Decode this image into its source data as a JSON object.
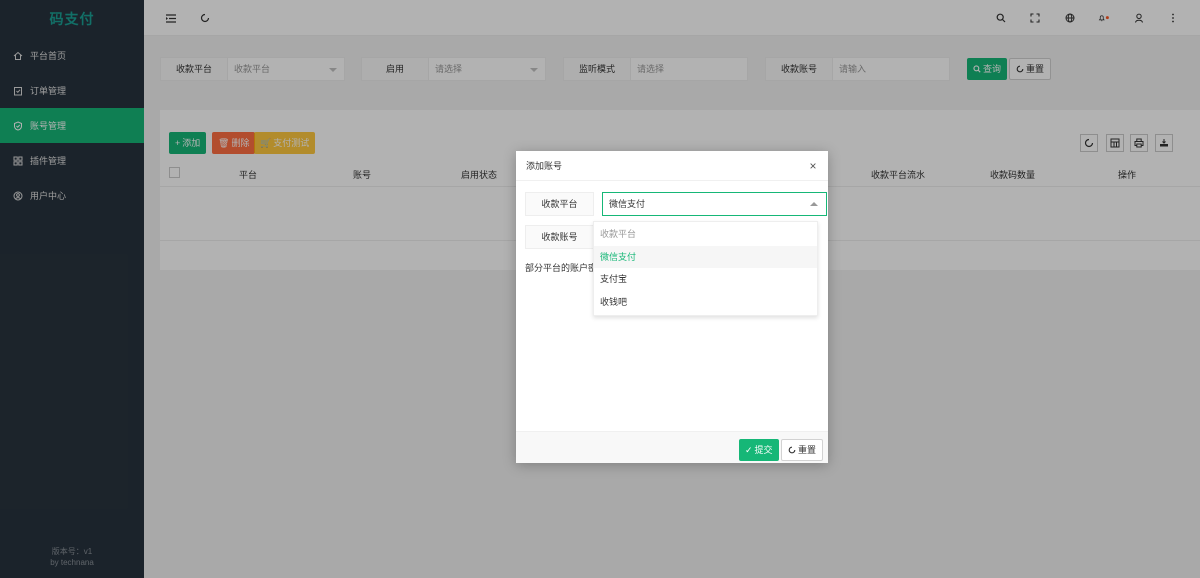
{
  "app": {
    "brand": "码支付",
    "version_line": "版本号：v1",
    "author_line": "by technana"
  },
  "sidebar": {
    "items": [
      {
        "label": "平台首页",
        "icon": "home-icon"
      },
      {
        "label": "订单管理",
        "icon": "order-icon"
      },
      {
        "label": "账号管理",
        "icon": "account-icon",
        "active": true
      },
      {
        "label": "插件管理",
        "icon": "plugin-icon"
      },
      {
        "label": "用户中心",
        "icon": "user-icon"
      }
    ]
  },
  "header": {
    "left_icons": [
      "menu-toggle-icon",
      "refresh-icon"
    ],
    "right_icons": [
      "search-icon",
      "fullscreen-icon",
      "globe-icon",
      "bell-icon",
      "user-icon",
      "more-icon"
    ]
  },
  "filter": {
    "platform_label": "收款平台",
    "platform_placeholder": "收款平台",
    "enabled_label": "启用",
    "enabled_placeholder": "请选择",
    "mode_label": "监听模式",
    "mode_placeholder": "请选择",
    "account_label": "收款账号",
    "account_placeholder": "请输入",
    "query_button": "查询",
    "reset_button": "重置"
  },
  "toolbar": {
    "add_button": "添加",
    "delete_button": "删除",
    "pay_test_button": "支付测试"
  },
  "table": {
    "headers": [
      "平台",
      "账号",
      "启用状态",
      "收款平台流水",
      "收款码数量",
      "操作"
    ]
  },
  "modal": {
    "title": "添加账号",
    "platform_label": "收款平台",
    "platform_value": "微信支付",
    "account_label": "收款账号",
    "note": "部分平台的账户密",
    "options": [
      {
        "label": "收款平台",
        "placeholder": true
      },
      {
        "label": "微信支付",
        "selected": true
      },
      {
        "label": "支付宝"
      },
      {
        "label": "收钱吧"
      }
    ],
    "submit_button": "提交",
    "reset_button": "重置"
  },
  "colors": {
    "sidebar_bg": "#28333e",
    "accent": "#16b777",
    "brand": "#1aa094"
  }
}
